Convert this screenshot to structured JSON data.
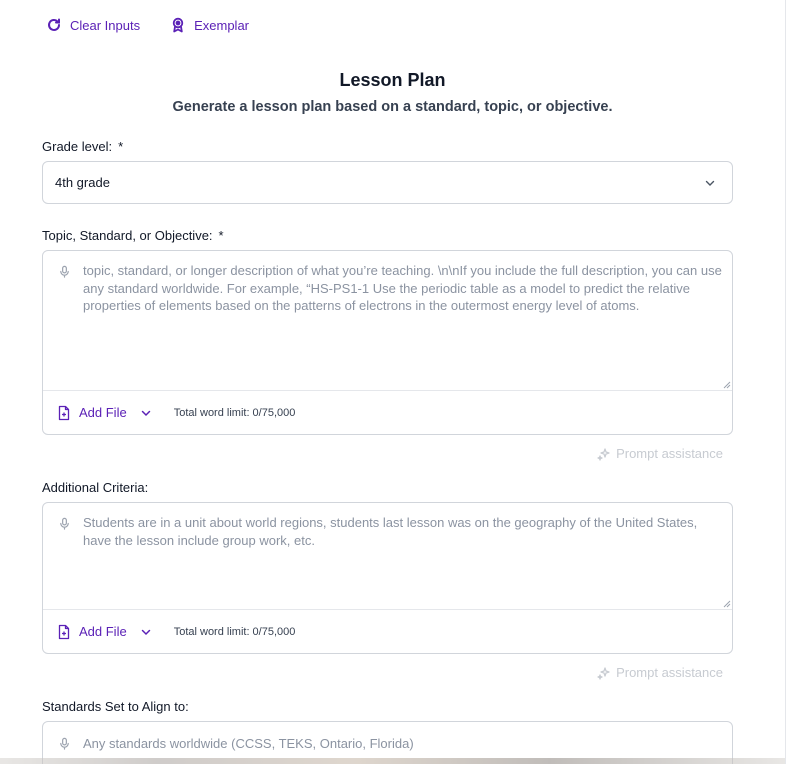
{
  "toolbar": {
    "clear_label": "Clear Inputs",
    "exemplar_label": "Exemplar"
  },
  "header": {
    "title": "Lesson Plan",
    "subtitle": "Generate a lesson plan based on a standard, topic, or objective."
  },
  "grade": {
    "label": "Grade level:",
    "required": "*",
    "value": "4th grade"
  },
  "topic": {
    "label": "Topic, Standard, or Objective:",
    "required": "*",
    "placeholder": "topic, standard, or longer description of what you’re teaching.  \\n\\nIf you include the full description, you can use any standard worldwide.  For example, “HS-PS1-1 Use the periodic table as a model to predict the relative properties of elements based on the patterns of electrons in the outermost energy level of atoms.",
    "add_file": "Add File",
    "word_limit": "Total word limit: 0/75,000",
    "assist": "Prompt assistance"
  },
  "criteria": {
    "label": "Additional Criteria:",
    "placeholder": "Students are in a unit about world regions, students last lesson was on the geography of the United States, have the lesson include group work, etc.",
    "add_file": "Add File",
    "word_limit": "Total word limit: 0/75,000",
    "assist": "Prompt assistance"
  },
  "standards": {
    "label": "Standards Set to Align to:",
    "placeholder": "Any standards worldwide (CCSS, TEKS, Ontario, Florida)"
  },
  "colors": {
    "accent": "#5b21b6",
    "border": "#d1d5db",
    "placeholder": "#8b93a1"
  },
  "icons": {
    "clear": "refresh-icon",
    "exemplar": "award-icon",
    "mic": "microphone-icon",
    "file": "file-plus-icon",
    "chevron": "chevron-down-icon",
    "assist": "sparkle-icon"
  }
}
